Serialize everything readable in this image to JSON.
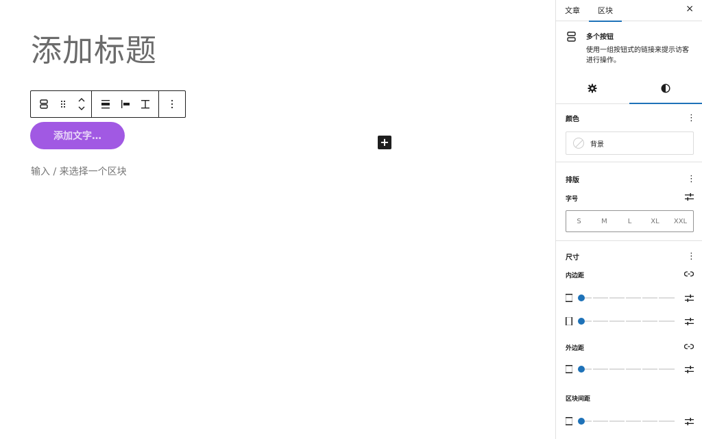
{
  "editor": {
    "post_title_placeholder": "添加标题",
    "button_placeholder": "添加文字…",
    "empty_block_hint": "输入 / 来选择一个区块",
    "inserter_label": "+"
  },
  "toolbar": {
    "icons": [
      "buttons-block-icon",
      "drag-handle-icon",
      "move-up-down-icon",
      "justify-center-icon",
      "justify-left-icon",
      "vertical-align-icon",
      "options-icon"
    ]
  },
  "sidebar": {
    "tabs": [
      "文章",
      "区块"
    ],
    "active_tab": "区块",
    "close_label": "×",
    "block_card": {
      "title": "多个按钮",
      "description": "使用一组按钮式的链接来提示访客进行操作。"
    },
    "sub_tabs": [
      "settings-gear-icon",
      "styles-half-circle-icon"
    ],
    "color_panel": {
      "title": "颜色",
      "items": [
        {
          "label": "背景"
        }
      ]
    },
    "typography_panel": {
      "title": "排版",
      "font_size_label": "字号",
      "size_options": [
        "S",
        "M",
        "L",
        "XL",
        "XXL"
      ]
    },
    "dimensions_panel": {
      "title": "尺寸",
      "padding_label": "内边距",
      "margin_label": "外边距",
      "block_spacing_label": "区块间距"
    }
  },
  "colors": {
    "button_bg": "#a159e3",
    "accent": "#1e72b8"
  }
}
